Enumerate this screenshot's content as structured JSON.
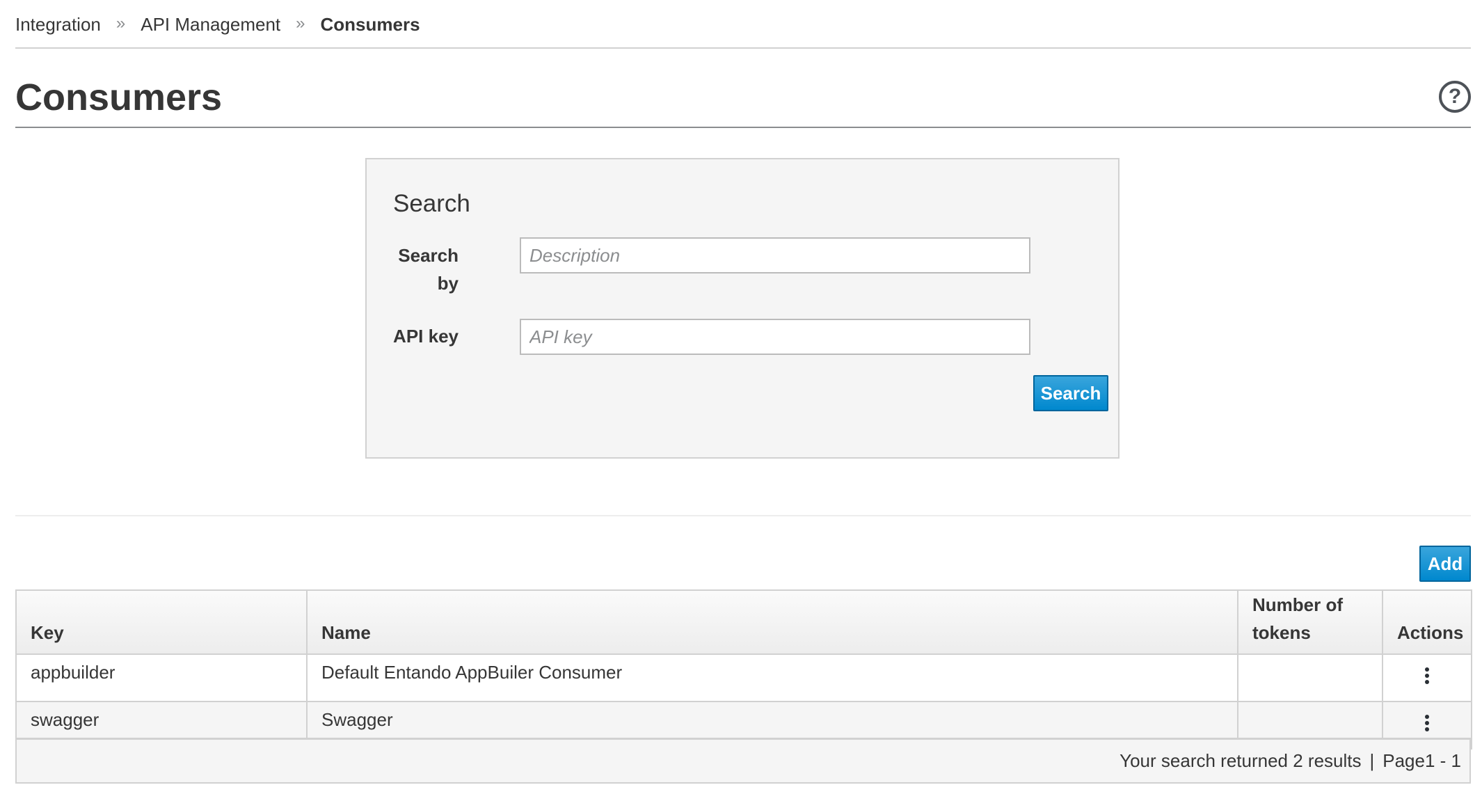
{
  "breadcrumb": {
    "items": [
      {
        "label": "Integration"
      },
      {
        "label": "API Management"
      },
      {
        "label": "Consumers"
      }
    ],
    "separator": "»"
  },
  "header": {
    "title": "Consumers",
    "help_icon": "question-circle-icon",
    "help_glyph": "?"
  },
  "search": {
    "heading": "Search",
    "search_by_label": "Search by",
    "description_placeholder": "Description",
    "description_value": "",
    "api_key_label": "API key",
    "api_key_placeholder": "API key",
    "api_key_value": "",
    "submit_label": "Search"
  },
  "toolbar": {
    "add_label": "Add"
  },
  "table": {
    "columns": {
      "key": "Key",
      "name": "Name",
      "tokens": "Number of tokens",
      "actions": "Actions"
    },
    "rows": [
      {
        "key": "appbuilder",
        "name": "Default Entando AppBuiler Consumer",
        "tokens": "",
        "actions_icon": "kebab-menu-icon"
      },
      {
        "key": "swagger",
        "name": "Swagger",
        "tokens": "",
        "actions_icon": "kebab-menu-icon"
      }
    ]
  },
  "pagination": {
    "results_text": "Your search returned 2 results",
    "separator": "|",
    "page_text": "Page1 - 1"
  },
  "colors": {
    "primary": "#0088ce",
    "primary_border": "#00659c",
    "text": "#363636",
    "border": "#d1d1d1",
    "panel_bg": "#f5f5f5"
  }
}
